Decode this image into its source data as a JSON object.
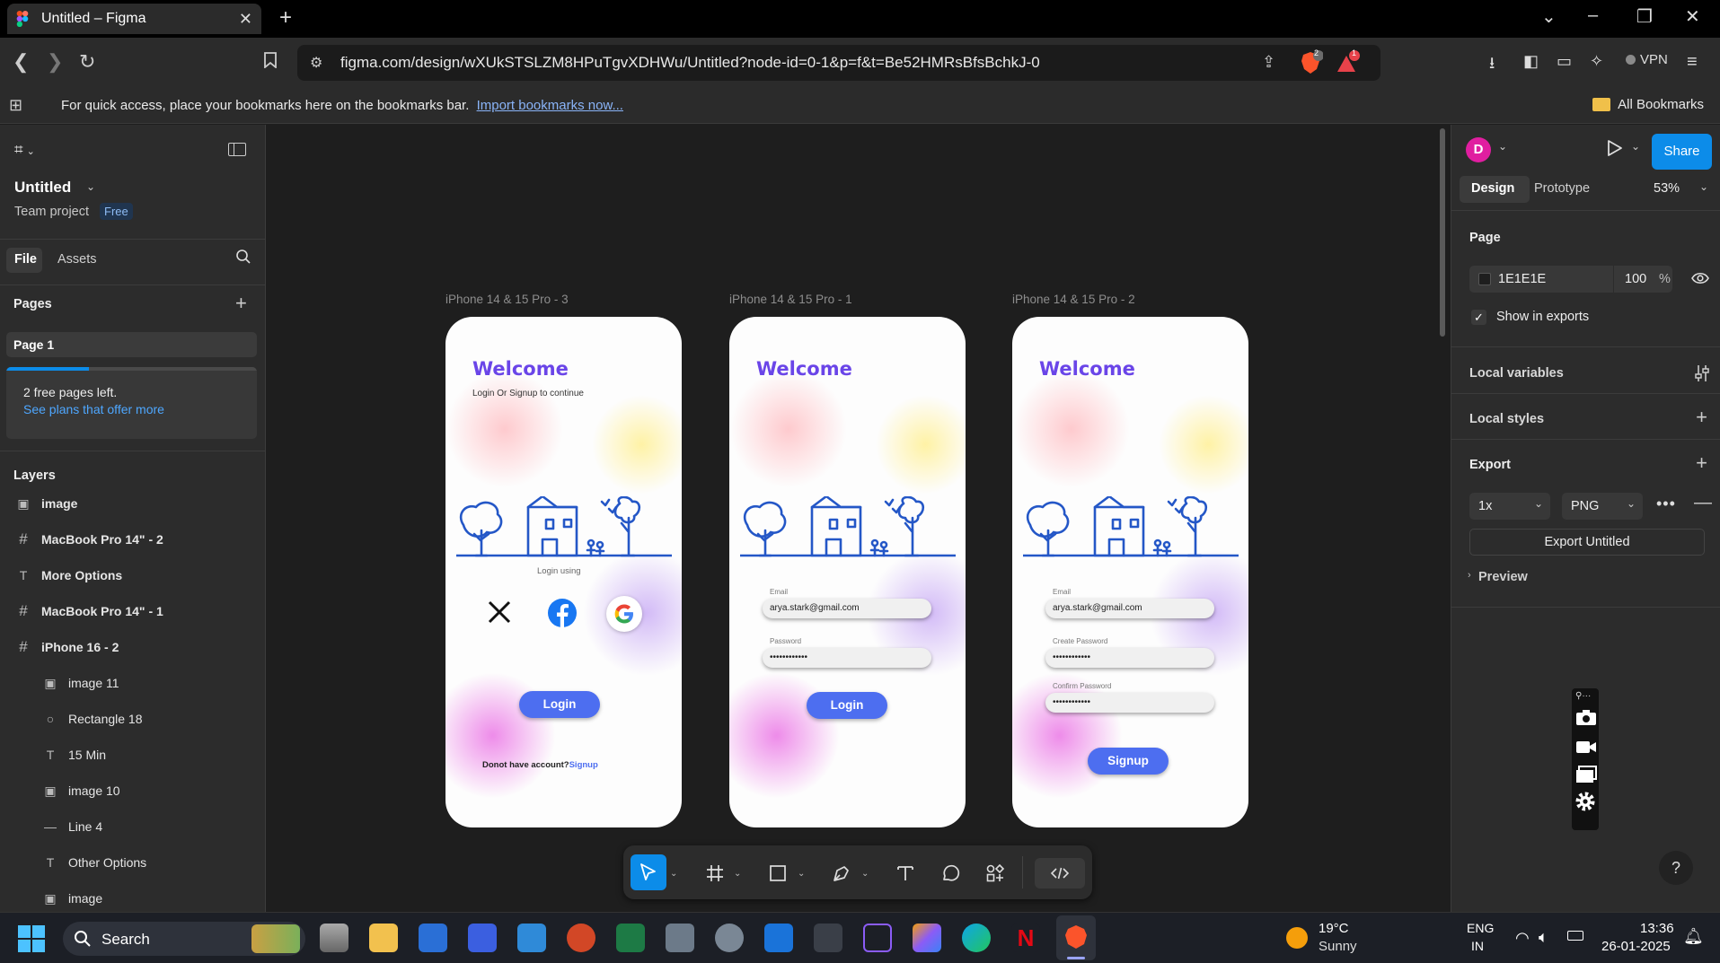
{
  "browser": {
    "tab_title": "Untitled – Figma",
    "tab_close": "✕",
    "new_tab": "+",
    "url": "figma.com/design/wXUkSTSLZM8HPuTgvXDHWu/Untitled?node-id=0-1&p=f&t=Be52HMRsBfsBchkJ-0",
    "brave_badge": "2",
    "alert_badge": "1",
    "vpn_label": "VPN",
    "bookmarks_message": "For quick access, place your bookmarks here on the bookmarks bar.",
    "bookmarks_link": "Import bookmarks now...",
    "all_bookmarks": "All Bookmarks"
  },
  "left_panel": {
    "file_name": "Untitled",
    "team": "Team project",
    "plan_badge": "Free",
    "tabs": [
      "File",
      "Assets"
    ],
    "pages_header": "Pages",
    "pages": [
      "Page 1"
    ],
    "free_pages_note": "2 free pages left.",
    "free_pages_link": "See plans that offer more",
    "free_pages_progress": 0.33,
    "layers_header": "Layers",
    "layers": [
      {
        "name": "image",
        "icon": "image-icon",
        "indent": 0
      },
      {
        "name": "MacBook Pro 14\" - 2",
        "icon": "frame-icon",
        "indent": 0
      },
      {
        "name": "More Options",
        "icon": "text-icon",
        "indent": 0
      },
      {
        "name": "MacBook Pro 14\" - 1",
        "icon": "frame-icon",
        "indent": 0
      },
      {
        "name": "iPhone 16 - 2",
        "icon": "frame-icon",
        "indent": 0
      },
      {
        "name": "image 11",
        "icon": "image-icon",
        "indent": 1
      },
      {
        "name": "Rectangle 18",
        "icon": "ellipse-icon",
        "indent": 1
      },
      {
        "name": "15 Min",
        "icon": "text-icon",
        "indent": 1
      },
      {
        "name": "image 10",
        "icon": "image-icon",
        "indent": 1
      },
      {
        "name": "Line 4",
        "icon": "line-icon",
        "indent": 1
      },
      {
        "name": "Other Options",
        "icon": "text-icon",
        "indent": 1
      },
      {
        "name": "image",
        "icon": "image-icon",
        "indent": 1
      }
    ]
  },
  "canvas": {
    "frames": [
      {
        "label": "iPhone 14 & 15 Pro - 3",
        "welcome": "Welcome",
        "subtitle": "Login Or Signup to continue",
        "login_using": "Login using",
        "button": "Login",
        "footer_text": "Donot have account?",
        "footer_link": "Signup"
      },
      {
        "label": "iPhone 14 & 15 Pro - 1",
        "welcome": "Welcome",
        "email_label": "Email",
        "email_value": "arya.stark@gmail.com",
        "password_label": "Password",
        "password_value": "••••••••••••",
        "button": "Login"
      },
      {
        "label": "iPhone 14 & 15 Pro - 2",
        "welcome": "Welcome",
        "email_label": "Email",
        "email_value": "arya.stark@gmail.com",
        "password_label": "Create Password",
        "password_value": "••••••••••••",
        "confirm_label": "Confirm Password",
        "confirm_value": "••••••••••••",
        "button": "Signup"
      }
    ],
    "toolbar_tools": [
      "move-tool",
      "frame-tool",
      "rectangle-tool",
      "pen-tool",
      "text-tool",
      "comment-tool",
      "actions-tool",
      "dev-mode-toggle"
    ]
  },
  "right_panel": {
    "avatar_initial": "D",
    "share_label": "Share",
    "tabs": [
      "Design",
      "Prototype"
    ],
    "zoom": "53%",
    "page_header": "Page",
    "page_color": "1E1E1E",
    "page_opacity": "100",
    "percent_sign": "%",
    "show_in_exports": "Show in exports",
    "local_variables": "Local variables",
    "local_styles": "Local styles",
    "export_header": "Export",
    "export_scale": "1x",
    "export_format": "PNG",
    "export_button": "Export Untitled",
    "preview_label": "Preview",
    "help_label": "?"
  },
  "taskbar": {
    "search_label": "Search",
    "weather_temp": "19°C",
    "weather_desc": "Sunny",
    "lang_top": "ENG",
    "lang_bottom": "IN",
    "time": "13:36",
    "date": "26-01-2025"
  },
  "colors": {
    "accent_blue": "#0c8ce9",
    "welcome_purple": "#6a45e8",
    "button_blue": "#4d6ef0",
    "avatar_magenta": "#e01ea0"
  }
}
